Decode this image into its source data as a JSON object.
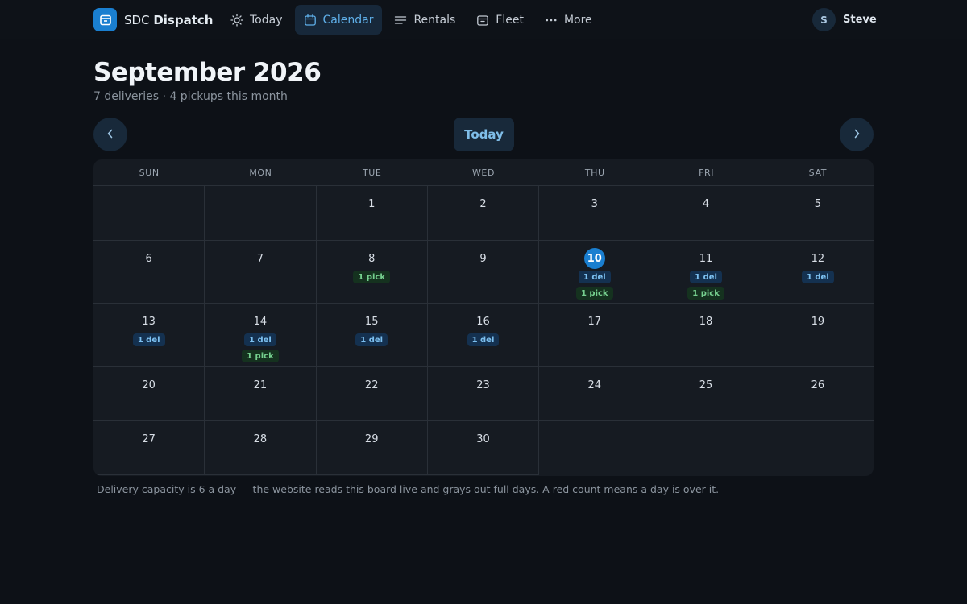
{
  "app": {
    "brand_prefix": "SDC",
    "brand_name": "Dispatch",
    "accent_color": "#1a7fd0"
  },
  "nav": {
    "items": [
      {
        "label": "Today",
        "icon": "sun-icon",
        "active": false
      },
      {
        "label": "Calendar",
        "icon": "calendar-icon",
        "active": true
      },
      {
        "label": "Rentals",
        "icon": "list-icon",
        "active": false
      },
      {
        "label": "Fleet",
        "icon": "box-icon",
        "active": false
      },
      {
        "label": "More",
        "icon": "more-dots-icon",
        "active": false
      }
    ]
  },
  "user": {
    "initial": "S",
    "name": "Steve"
  },
  "page": {
    "title": "September 2026",
    "subtitle": "7 deliveries · 4 pickups this month"
  },
  "controls": {
    "today_label": "Today",
    "prev_icon": "chevron-left-icon",
    "next_icon": "chevron-right-icon"
  },
  "calendar": {
    "weekdays": [
      "SUN",
      "MON",
      "TUE",
      "WED",
      "THU",
      "FRI",
      "SAT"
    ],
    "first_weekday_index": 2,
    "days_in_month": 30,
    "today": 10,
    "events": [
      {
        "day": 8,
        "badges": [
          {
            "type": "pick",
            "label": "1 pick"
          }
        ]
      },
      {
        "day": 10,
        "badges": [
          {
            "type": "del",
            "label": "1 del"
          },
          {
            "type": "pick",
            "label": "1 pick"
          }
        ]
      },
      {
        "day": 11,
        "badges": [
          {
            "type": "del",
            "label": "1 del"
          },
          {
            "type": "pick",
            "label": "1 pick"
          }
        ]
      },
      {
        "day": 12,
        "badges": [
          {
            "type": "del",
            "label": "1 del"
          }
        ]
      },
      {
        "day": 13,
        "badges": [
          {
            "type": "del",
            "label": "1 del"
          }
        ]
      },
      {
        "day": 14,
        "badges": [
          {
            "type": "del",
            "label": "1 del"
          },
          {
            "type": "pick",
            "label": "1 pick"
          }
        ]
      },
      {
        "day": 15,
        "badges": [
          {
            "type": "del",
            "label": "1 del"
          }
        ]
      },
      {
        "day": 16,
        "badges": [
          {
            "type": "del",
            "label": "1 del"
          }
        ]
      }
    ]
  },
  "footnote": "Delivery capacity is 6 a day — the website reads this board live and grays out full days. A red count means a day is over it."
}
